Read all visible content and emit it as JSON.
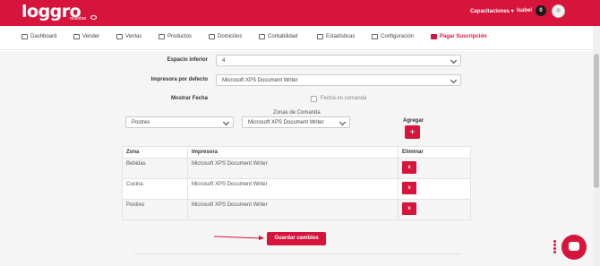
{
  "topbar": {
    "logo": "loggro",
    "logo_sub": "restobar",
    "menu_label": "Capacitaciones",
    "user_name": "Isabel",
    "notifications": "0"
  },
  "nav": {
    "items": [
      {
        "label": "Dashboard",
        "icon": "dashboard-icon"
      },
      {
        "label": "Vender",
        "icon": "cart-icon"
      },
      {
        "label": "Ventas",
        "icon": "tag-icon"
      },
      {
        "label": "Productos",
        "icon": "basket-icon"
      },
      {
        "label": "Domicilios",
        "icon": "bike-icon"
      },
      {
        "label": "Contabilidad",
        "icon": "bank-icon"
      },
      {
        "label": "Estadísticas",
        "icon": "chart-icon"
      },
      {
        "label": "Configuración",
        "icon": "gear-icon"
      },
      {
        "label": "Pagar Suscripción",
        "icon": "card-icon"
      }
    ]
  },
  "form": {
    "espacio_inferior_label": "Espacio inferior",
    "espacio_inferior_value": "4",
    "impresora_label": "Impresora por defecto",
    "impresora_value": "Microsoft XPS Document Writer",
    "mostrar_fecha_label": "Mostrar Fecha",
    "fecha_checkbox_label": "Fecha en comanda",
    "zona_select_value": "Postres",
    "zonas_label": "Zonas de Comanda",
    "zonas_printer_value": "Microsoft XPS Document Writer",
    "agregar_label": "Agregar",
    "add_button": "+"
  },
  "table": {
    "headers": [
      "Zona",
      "Impresora",
      "Eliminar"
    ],
    "rows": [
      {
        "zona": "Bebidas",
        "impresora": "Microsoft XPS Document Writer",
        "delete": "x"
      },
      {
        "zona": "Cocina",
        "impresora": "Microsoft XPS Document Writer",
        "delete": "x"
      },
      {
        "zona": "Postres",
        "impresora": "Microsoft XPS Document Writer",
        "delete": "x"
      }
    ]
  },
  "save_button": "Guardar cambios",
  "colors": {
    "brand": "#d6143c"
  }
}
